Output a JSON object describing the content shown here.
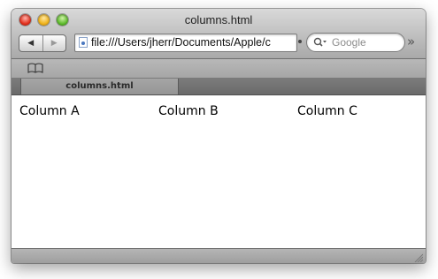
{
  "window": {
    "title": "columns.html"
  },
  "toolbar": {
    "back_icon": "back-arrow-icon",
    "forward_icon": "forward-arrow-icon",
    "url": "file:///Users/jherr/Documents/Apple/c",
    "search_placeholder": "Google",
    "overflow_label": "»"
  },
  "bookmarks": {
    "icon": "book-icon"
  },
  "tabs": [
    {
      "label": "columns.html"
    }
  ],
  "page": {
    "columns": [
      "Column A",
      "Column B",
      "Column C"
    ]
  },
  "colors": {
    "close": "#e2301d",
    "minimize": "#f0b31c",
    "zoom": "#5fbb2e"
  }
}
